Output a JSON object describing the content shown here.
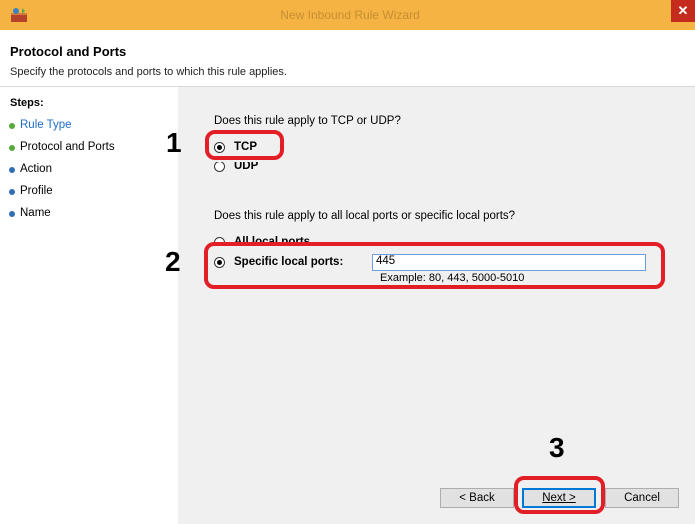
{
  "window": {
    "title": "New Inbound Rule Wizard",
    "close_glyph": "✕"
  },
  "header": {
    "title": "Protocol and Ports",
    "subtitle": "Specify the protocols and ports to which this rule applies."
  },
  "steps": {
    "label": "Steps:",
    "items": [
      {
        "label": "Rule Type",
        "color": "#58a83a"
      },
      {
        "label": "Protocol and Ports",
        "color": "#58a83a"
      },
      {
        "label": "Action",
        "color": "#2f6fb7"
      },
      {
        "label": "Profile",
        "color": "#2f6fb7"
      },
      {
        "label": "Name",
        "color": "#2f6fb7"
      }
    ]
  },
  "protocol": {
    "question": "Does this rule apply to TCP or UDP?",
    "tcp_label": "TCP",
    "udp_label": "UDP",
    "selected": "TCP"
  },
  "ports": {
    "question": "Does this rule apply to all local ports or specific local ports?",
    "all_label": "All local ports",
    "specific_label": "Specific local ports:",
    "selected": "Specific local ports",
    "value": "445",
    "example": "Example: 80, 443, 5000-5010"
  },
  "buttons": {
    "back": "< Back",
    "next": "Next >",
    "cancel": "Cancel"
  },
  "callouts": {
    "one": "1",
    "two": "2",
    "three": "3",
    "color": "#e21f26"
  }
}
